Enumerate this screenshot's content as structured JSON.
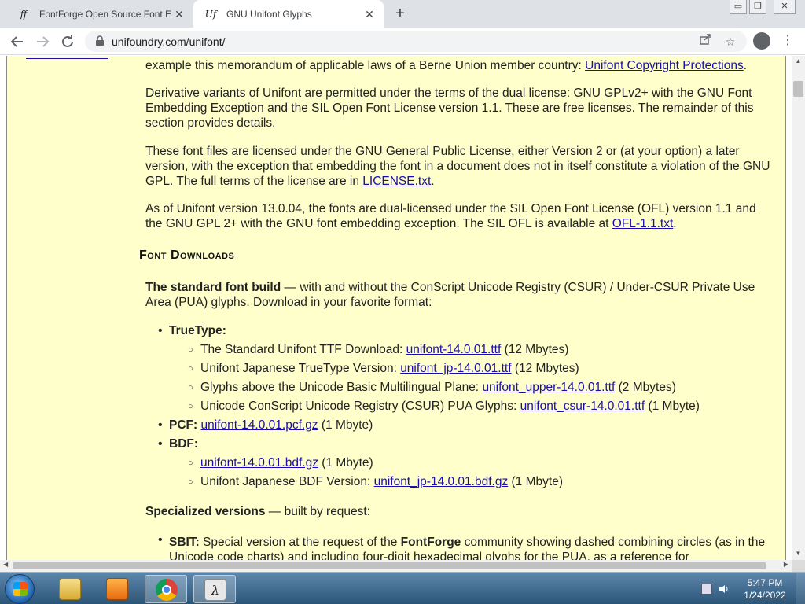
{
  "browser": {
    "tabs": [
      {
        "title": "FontForge Open Source Font Edi",
        "favicon": "ff"
      },
      {
        "title": "GNU Unifont Glyphs",
        "favicon": "Uf"
      }
    ],
    "new_tab_symbol": "+",
    "window_controls": [
      "▭",
      "❐",
      "✕"
    ],
    "url": "unifoundry.com/unifont/"
  },
  "page": {
    "para_top": "example this memorandum of applicable laws of a Berne Union member country: ",
    "para_top_link": "Unifont Copyright Protections",
    "para_top_end": ".",
    "para_derivative": "Derivative variants of Unifont are permitted under the terms of the dual license: GNU GPLv2+ with the GNU Font Embedding Exception and the SIL Open Font License version 1.1. These are free licenses. The remainder of this section provides details.",
    "para_gpl": "These font files are licensed under the GNU General Public License, either Version 2 or (at your option) a later version, with the exception that embedding the font in a document does not in itself constitute a violation of the GNU GPL. The full terms of the license are in ",
    "para_gpl_link": "LICENSE.txt",
    "para_gpl_end": ".",
    "para_ofl": "As of Unifont version 13.0.04, the fonts are dual-licensed under the SIL Open Font License (OFL) version 1.1 and the GNU GPL 2+ with the GNU font embedding exception. The SIL OFL is available at ",
    "para_ofl_link": "OFL-1.1.txt",
    "para_ofl_end": ".",
    "heading_downloads": "Font Downloads",
    "std_bold": "The standard font build",
    "std_rest": " — with and without the ConScript Unicode Registry (CSUR) / Under-CSUR Private Use Area (PUA) glyphs. Download in your favorite format:",
    "truetype_label": "TrueType:",
    "tt_items": [
      {
        "text": "The Standard Unifont TTF Download: ",
        "link": "unifont-14.0.01.ttf",
        "size": " (12 Mbytes)"
      },
      {
        "text": "Unifont Japanese TrueType Version: ",
        "link": "unifont_jp-14.0.01.ttf",
        "size": " (12 Mbytes)"
      },
      {
        "text": "Glyphs above the Unicode Basic Multilingual Plane: ",
        "link": "unifont_upper-14.0.01.ttf",
        "size": " (2 Mbytes)"
      },
      {
        "text": "Unicode ConScript Unicode Registry (CSUR) PUA Glyphs: ",
        "link": "unifont_csur-14.0.01.ttf",
        "size": " (1 Mbyte)"
      }
    ],
    "pcf_label": "PCF:",
    "pcf_link": "unifont-14.0.01.pcf.gz",
    "pcf_size": " (1 Mbyte)",
    "bdf_label": "BDF:",
    "bdf_items": [
      {
        "text": "",
        "link": "unifont-14.0.01.bdf.gz",
        "size": " (1 Mbyte)"
      },
      {
        "text": "Unifont Japanese BDF Version: ",
        "link": "unifont_jp-14.0.01.bdf.gz",
        "size": " (1 Mbyte)"
      }
    ],
    "special_bold": "Specialized versions",
    "special_rest": " — built by request:",
    "sbit_label": "SBIT:",
    "sbit_text1": " Special version at the request of the ",
    "sbit_bold": "FontForge",
    "sbit_text2": " community showing dashed combining circles (as in the Unicode code charts) and including four-digit hexadecimal glyphs for the PUA, as a reference for"
  },
  "taskbar": {
    "time": "5:47 PM",
    "date": "1/24/2022"
  }
}
